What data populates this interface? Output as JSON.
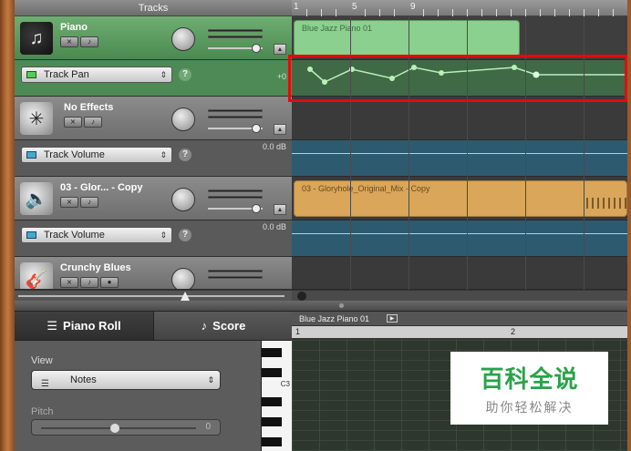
{
  "header": {
    "tracks_title": "Tracks"
  },
  "ruler": {
    "marks": [
      "1",
      "5",
      "9"
    ]
  },
  "tracks": [
    {
      "name": "Piano",
      "icon": "piano-icon",
      "automation": {
        "label": "Track Pan",
        "value": "+0"
      }
    },
    {
      "name": "No Effects",
      "icon": "sparkle-icon",
      "automation": {
        "label": "Track Volume",
        "value": "0.0 dB"
      }
    },
    {
      "name": "03 - Glor... - Copy",
      "icon": "speaker-icon",
      "automation": {
        "label": "Track Volume",
        "value": "0.0 dB"
      }
    },
    {
      "name": "Crunchy Blues",
      "icon": "guitar-icon"
    }
  ],
  "regions": {
    "piano_region": "Blue Jazz Piano 01",
    "audio_region": "03 - Gloryhole_Original_Mix - Copy"
  },
  "editor": {
    "tabs": [
      {
        "label": "Piano Roll",
        "icon": "piano-roll-icon"
      },
      {
        "label": "Score",
        "icon": "note-icon"
      }
    ],
    "view_label": "View",
    "view_value": "Notes",
    "pitch_label": "Pitch",
    "pitch_value": "0",
    "key_label": "C3",
    "roll_title": "Blue Jazz Piano 01",
    "roll_ruler": [
      "1",
      "2"
    ]
  },
  "watermark": {
    "title": "百科全说",
    "subtitle": "助你轻松解决"
  },
  "colors": {
    "highlight": "#e20b0b",
    "green_track": "#4a8a50",
    "audio_region": "#d9a65a"
  }
}
